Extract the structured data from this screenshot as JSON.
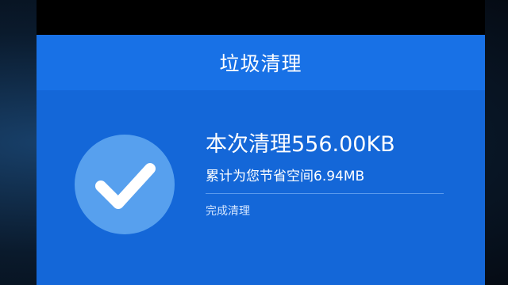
{
  "header": {
    "title": "垃圾清理"
  },
  "result": {
    "cleaned_label": "本次清理",
    "cleaned_size": "556.00KB",
    "saved_label": "累计为您节省空间",
    "saved_size": "6.94MB",
    "status": "完成清理"
  },
  "icons": {
    "check": "check-icon"
  },
  "colors": {
    "primary": "#1467d8",
    "title_bar": "#1871e6",
    "check_circle": "#57a0ee",
    "text": "#ffffff"
  }
}
